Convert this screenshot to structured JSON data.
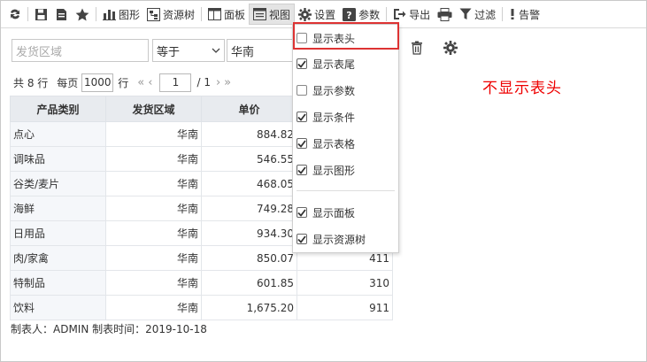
{
  "toolbar": {
    "items": [
      {
        "label": "",
        "icon": "refresh-icon"
      },
      {
        "label": "",
        "icon": "save-icon"
      },
      {
        "label": "",
        "icon": "save-as-icon"
      },
      {
        "label": "",
        "icon": "star-icon"
      },
      {
        "label": "图形",
        "icon": "bar-chart-icon"
      },
      {
        "label": "资源树",
        "icon": "resource-tree-icon"
      },
      {
        "label": "面板",
        "icon": "panel-icon"
      },
      {
        "label": "视图",
        "icon": "view-icon"
      },
      {
        "label": "设置",
        "icon": "gear-icon"
      },
      {
        "label": "参数",
        "icon": "help-icon"
      },
      {
        "label": "导出",
        "icon": "export-icon"
      },
      {
        "label": "",
        "icon": "print-icon"
      },
      {
        "label": "过滤",
        "icon": "filter-icon"
      },
      {
        "label": "告警",
        "icon": "alert-icon"
      }
    ]
  },
  "filter": {
    "field_placeholder": "发货区域",
    "operator": "等于",
    "value": "华南"
  },
  "pager": {
    "total": "共 8 行",
    "per_page_label": "每页",
    "per_page": "1000",
    "rows_unit": "行",
    "page": "1",
    "of_pages": "/ 1"
  },
  "table": {
    "headers": [
      "产品类别",
      "发货区域",
      "单价",
      ""
    ],
    "rows": [
      [
        "点心",
        "华南",
        "884.82",
        ""
      ],
      [
        "调味品",
        "华南",
        "546.55",
        ""
      ],
      [
        "谷类/麦片",
        "华南",
        "468.05",
        ""
      ],
      [
        "海鲜",
        "华南",
        "749.28",
        ""
      ],
      [
        "日用品",
        "华南",
        "934.30",
        ""
      ],
      [
        "肉/家禽",
        "华南",
        "850.07",
        "411"
      ],
      [
        "特制品",
        "华南",
        "601.85",
        "310"
      ],
      [
        "饮料",
        "华南",
        "1,675.20",
        "911"
      ]
    ]
  },
  "footnote": "制表人：ADMIN  制表时间：2019-10-18",
  "annotation": "不显示表头",
  "view_menu": {
    "items": [
      {
        "label": "显示表头",
        "checked": false
      },
      {
        "label": "显示表尾",
        "checked": true
      },
      {
        "label": "显示参数",
        "checked": false
      },
      {
        "label": "显示条件",
        "checked": true
      },
      {
        "label": "显示表格",
        "checked": true
      },
      {
        "label": "显示图形",
        "checked": true
      },
      {
        "label": "显示面板",
        "checked": true
      },
      {
        "label": "显示资源树",
        "checked": true
      }
    ]
  },
  "colors": {
    "highlight": "#dd3333",
    "annotation": "#ee0000",
    "header_bg": "#e8ebef"
  }
}
